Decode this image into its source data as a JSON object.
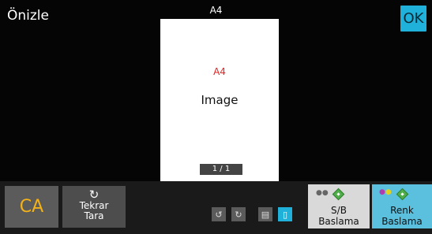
{
  "header": {
    "title": "Önizle",
    "ok_label": "OK",
    "paper_size": "A4"
  },
  "preview": {
    "paper_size": "A4",
    "image_label": "Image",
    "page_counter": "1 / 1"
  },
  "actions": {
    "ca_label": "CA",
    "rescan_line1": "Tekrar",
    "rescan_line2": "Tara",
    "bw_start_line1": "S/B",
    "bw_start_line2": "Baslama",
    "color_start_line1": "Renk",
    "color_start_line2": "Baslama"
  },
  "icons": {
    "rescan": "refresh-icon",
    "rotate_left": "rotate-left-icon",
    "rotate_right": "rotate-right-icon",
    "view_list": "page-list-icon",
    "view_single": "page-single-icon",
    "start": "start-diamond-icon"
  },
  "colors": {
    "accent": "#1fb1d9",
    "ca_text": "#f2b21b",
    "size_red": "#e52222",
    "start_green": "#4fae49"
  }
}
